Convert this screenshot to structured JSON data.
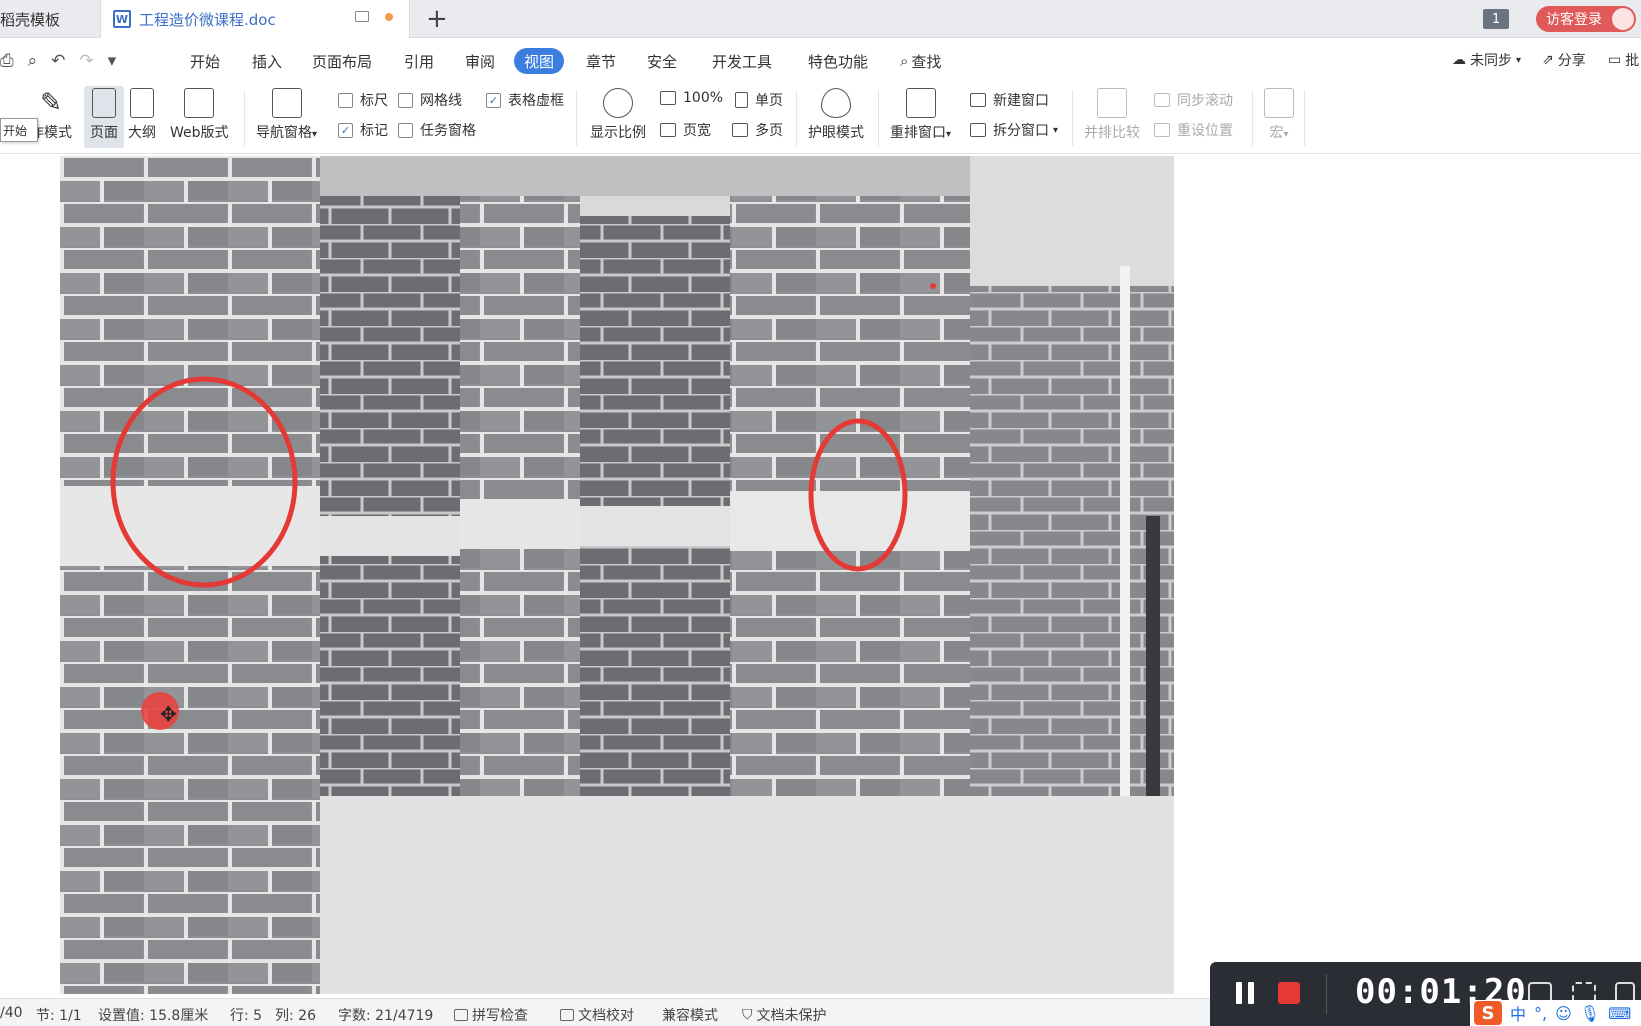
{
  "tabs": {
    "inactive_label": "稻壳模板",
    "active_label": "工程造价微课程.doc",
    "active_icon_letter": "W"
  },
  "titlebar": {
    "window_count": "1",
    "login_label": "访客登录"
  },
  "menu": {
    "items": [
      "开始",
      "插入",
      "页面布局",
      "引用",
      "审阅",
      "视图",
      "章节",
      "安全",
      "开发工具",
      "特色功能",
      "查找"
    ],
    "active": "视图",
    "sync_label": "未同步",
    "share_label": "分享",
    "comment_label": "批"
  },
  "ribbon": {
    "tooltip": "开始",
    "write_mode": "作模式",
    "page_view": "页面",
    "outline": "大纲",
    "web_layout": "Web版式",
    "nav_pane": "导航窗格",
    "ruler": "标尺",
    "gridlines": "网格线",
    "table_gridlines": "表格虚框",
    "marks": "标记",
    "task_pane": "任务窗格",
    "zoom": "显示比例",
    "zoom_100": "100%",
    "single_page": "单页",
    "page_width": "页宽",
    "multi_page": "多页",
    "eye_care": "护眼模式",
    "rearrange": "重排窗口",
    "new_window": "新建窗口",
    "split_window": "拆分窗口",
    "side_by_side": "并排比较",
    "sync_scroll": "同步滚动",
    "reset_position": "重设位置",
    "macro": "宏",
    "checks": {
      "ruler": false,
      "gridlines": false,
      "table_gridlines": true,
      "marks": true,
      "task_pane": false
    }
  },
  "status": {
    "page": "/40",
    "section": "节: 1/1",
    "setting": "设置值: 15.8厘米",
    "row": "行: 5",
    "col": "列: 26",
    "words": "字数: 21/4719",
    "spell": "拼写检查",
    "proof": "文档校对",
    "compat": "兼容模式",
    "protect": "文档未保护"
  },
  "recorder": {
    "time": "00:01:20"
  },
  "ime": {
    "logo": "S",
    "lang": "中",
    "punct": "°,"
  },
  "colors": {
    "accent": "#3b7ee0",
    "annotation_red": "#e53935",
    "login_bg": "#e05a5a"
  }
}
